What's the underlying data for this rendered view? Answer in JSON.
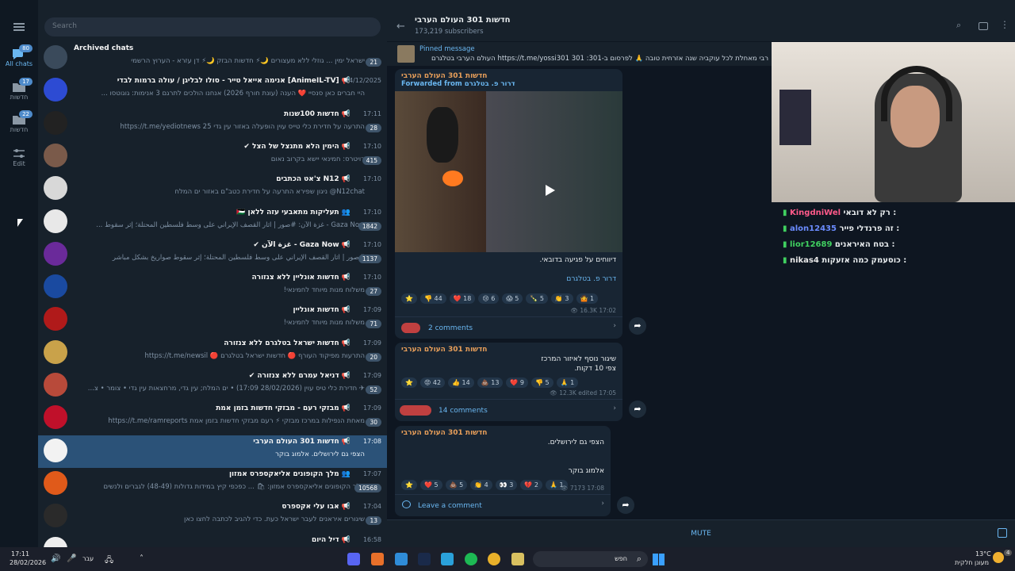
{
  "sidebar": {
    "items": [
      {
        "label": "All chats",
        "badge": "80"
      },
      {
        "label": "חדשות",
        "badge": "17"
      },
      {
        "label": "חדשות",
        "badge": "22"
      },
      {
        "label": "Edit"
      }
    ]
  },
  "search": {
    "placeholder": "Search"
  },
  "chats": [
    {
      "title": "Archived chats",
      "preview": "ישראל ימין ... גוזלי ללא מעצורים 🌙⚡ חדשות הבזק 🌙⚡ דן עזרא - הערוץ הרשמי",
      "time": "",
      "count": "21",
      "avatar": "archive-icon",
      "color": "#3a4a5b"
    },
    {
      "title": "📢 [AnimeIL-TV] אנימה אייאל טייר - סולו לבליגן / עולה ברמות לבדי",
      "preview": "היי חברים כאן סנסיי ❤️ הענה (עונת חורף 2026) אנחנו הולכים לתרגם 3 אנימות: גוגוטסו ...",
      "time": "24/12/2025",
      "count": "",
      "color": "#2d4bd3"
    },
    {
      "title": "📢 חדשות 100שנות",
      "preview": "התרעה על חדירת כלי טייס עוין הופעלה באזור עין גדי 25 https://t.me/yediotnews",
      "time": "17:11",
      "count": "28",
      "color": "#222"
    },
    {
      "title": "📢 הימין הלא מתנצל של הצל ✔",
      "preview": "רויטרס: חמינאי יישא בקרוב נאום",
      "time": "17:10",
      "count": "415",
      "color": "#7a5a4a"
    },
    {
      "title": "📢 N12 צ'אט הכתבים",
      "preview": "N12chat@ ניגון שפירא התרעה על חדירת כטב\"ם באזור ים המלח",
      "time": "17:10",
      "count": "",
      "color": "#d8d8d8"
    },
    {
      "title": "👥 תעליקות מתאבעי עזה ללאן 🇵🇸",
      "preview": "Gaza Now - غزة الآن: #صور | آثار القصف الإيراني على وسط فلسطين المحتلة؛ إثر سقوط ...",
      "time": "17:10",
      "count": "1842",
      "color": "#e8e8e8"
    },
    {
      "title": "📢 Gaza Now - غزة الآن ✔",
      "preview": "#صور | آثار القصف الإيراني على وسط فلسطين المحتلة؛ إثر سقوط صواريخ بشكل مباشر",
      "time": "17:10",
      "count": "1137",
      "color": "#6a2a9a"
    },
    {
      "title": "📢 חדשות אונליין ללא צנזורה",
      "preview": "משלוח מנות מיוחד לחמינאי!",
      "time": "17:10",
      "count": "27",
      "color": "#1a4aa0"
    },
    {
      "title": "📢 חדשות אונליין",
      "preview": "משלוח מנות מיוחד לחמינאי!",
      "time": "17:09",
      "count": "71",
      "color": "#b01a1a"
    },
    {
      "title": "📢 חדשות ישראל בטלגרם ללא צנזורה",
      "preview": "התרעות מפיקוד העורף 🔴 חדשות ישראל בטלגרם 🔴 https://t.me/newsil",
      "time": "17:09",
      "count": "20",
      "color": "#c9a24a"
    },
    {
      "title": "📢 דניאל עמרם ללא צנזורה ✔",
      "preview": "✈ חדירת כלי טיס עוין (28/02/2026 17:09) • ים המלח; עין גדי, מרחצאות עין גדי • צומר • צ...",
      "time": "17:09",
      "count": "52",
      "color": "#b84a3a"
    },
    {
      "title": "📢 מבזקי רעם - מבזקי חדשות בזמן אמת",
      "preview": "מאחת הנפילות במרכז מבזקי ⚡ רעם מבזקי חדשות בזמן אמת https://t.me/ramreports",
      "time": "17:09",
      "count": "30",
      "color": "#c0102a"
    },
    {
      "title": "📢 חדשות 301 העולם הערבי",
      "preview": "הצפי גם לירושלים. אלמוג בוקר",
      "time": "17:08",
      "count": "",
      "color": "#f2f2f2"
    },
    {
      "title": "👥 מלך הקופונים אליאקספרס אמזון",
      "preview": "מלך הקופונים אליאקספרס אמזון: 🛍 ... כפכפי קיץ במידות גדולות (48-49) לגברים ולנשים",
      "time": "17:07",
      "count": "10568",
      "color": "#e05a1a"
    },
    {
      "title": "📢 אבו עלי אקספרס",
      "preview": "שיגורים איראנים לעבר ישראל כעת. כדי להגיב לכתבה לחצו כאן",
      "time": "17:04",
      "count": "13",
      "color": "#2a2a2a"
    },
    {
      "title": "📢 דיל היום",
      "preview": "",
      "time": "16:58",
      "count": "",
      "color": "#eee"
    }
  ],
  "channel": {
    "title": "חדשות 301 העולם הערבי",
    "subscribers": "173,219 subscribers",
    "pinned_label": "Pinned message",
    "pinned_text": "רבי מאחלת לכל עוקביה שנה אזרחית טובה 🙏 לפרסום ב-301: https://t.me/yossi301 301 העולם הערבי בטלגרם"
  },
  "messages": [
    {
      "title": "חדשות 301 העולם הערבי",
      "forwarded": "Forwarded from",
      "forwarded_name": "דרור פ. בטלגרם",
      "text": "דיווחים על פגיעה בדובאי.",
      "signature": "דרור פ. בטלגרם",
      "reactions": [
        "⭐",
        "👎 44",
        "❤️ 18",
        "😢 6",
        "😱 5",
        "🍾 5",
        "👏 3",
        "🤷 1"
      ],
      "views": "16.3K",
      "time": "17:02",
      "comments": "2 comments"
    },
    {
      "title": "חדשות 301 העולם הערבי",
      "text": "שיגור נוסף לאיזור המרכז",
      "text2": "צפי 10 דקות.",
      "reactions": [
        "⭐",
        "😡 42",
        "👍 14",
        "💩 13",
        "❤️ 9",
        "👎 5",
        "🙏 1"
      ],
      "views": "12.3K",
      "time": "edited 17:05",
      "comments": "14 comments"
    },
    {
      "title": "חדשות 301 העולם הערבי",
      "text": "הצפי גם לירושלים.",
      "text2": "אלמוג בוקר",
      "reactions": [
        "⭐",
        "❤️ 5",
        "💩 5",
        "👏 4",
        "👀 3",
        "💔 2",
        "🙏 1"
      ],
      "views": "7173",
      "time": "17:08",
      "comments": "Leave a comment"
    }
  ],
  "twitch": {
    "title": "רק לא דובאי :KingdniWel",
    "lines": [
      {
        "user": "alon12435",
        "text": "זה פרנדלי פייר :",
        "color": "#6b8cff"
      },
      {
        "user": "lior12689",
        "text": "בטח האיראנים :",
        "color": "#40d060"
      },
      {
        "user": "nikas4",
        "text": "כוסעמק כמה אזעקות :",
        "color": "#e8e8e8"
      }
    ],
    "first_user": "KingdniWel",
    "first_text": "רק לא דובאי :",
    "first_color": "#ff5a8a"
  },
  "mute_label": "MUTE",
  "taskbar": {
    "time": "17:11",
    "date": "28/02/2026",
    "lang": "עבר",
    "search": "חפש",
    "temp": "13°C",
    "weather": "מעונן חלקית",
    "notif": "4"
  }
}
